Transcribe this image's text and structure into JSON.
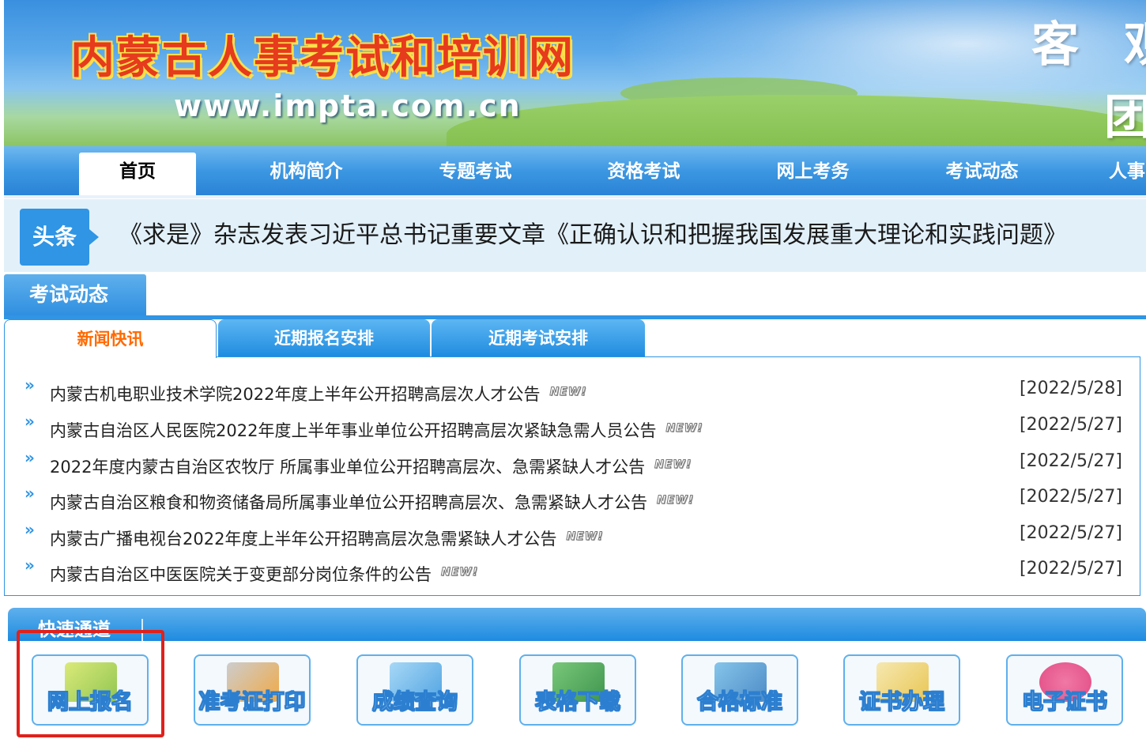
{
  "banner": {
    "site_title": "内蒙古人事考试和培训网",
    "site_url": "www.impta.com.cn",
    "slogan_line1": "客 观",
    "slogan_line2": "团"
  },
  "nav": {
    "items": [
      "首页",
      "机构简介",
      "专题考试",
      "资格考试",
      "网上考务",
      "考试动态",
      "人事"
    ]
  },
  "headline": {
    "badge": "头条",
    "text": "《求是》杂志发表习近平总书记重要文章《正确认识和把握我国发展重大理论和实践问题》"
  },
  "exam_news": {
    "section_title": "考试动态",
    "tabs": [
      "新闻快讯",
      "近期报名安排",
      "近期考试安排"
    ],
    "new_badge": "NEW!",
    "items": [
      {
        "title": "内蒙古机电职业技术学院2022年度上半年公开招聘高层次人才公告",
        "date": "[2022/5/28]"
      },
      {
        "title": "内蒙古自治区人民医院2022年度上半年事业单位公开招聘高层次紧缺急需人员公告",
        "date": "[2022/5/27]"
      },
      {
        "title": "2022年度内蒙古自治区农牧厅 所属事业单位公开招聘高层次、急需紧缺人才公告",
        "date": "[2022/5/27]"
      },
      {
        "title": "内蒙古自治区粮食和物资储备局所属事业单位公开招聘高层次、急需紧缺人才公告",
        "date": "[2022/5/27]"
      },
      {
        "title": "内蒙古广播电视台2022年度上半年公开招聘高层次急需紧缺人才公告",
        "date": "[2022/5/27]"
      },
      {
        "title": "内蒙古自治区中医医院关于变更部分岗位条件的公告",
        "date": "[2022/5/27]"
      }
    ]
  },
  "quick_access": {
    "title": "快速通道",
    "buttons": [
      "网上报名",
      "准考证打印",
      "成绩查询",
      "表格下载",
      "合格标准",
      "证书办理",
      "电子证书"
    ]
  },
  "colors": {
    "primary_blue": "#2f95e4",
    "active_tab_text": "#ff6a00",
    "highlight_red": "#e0211c",
    "title_red": "#e63b1c"
  }
}
